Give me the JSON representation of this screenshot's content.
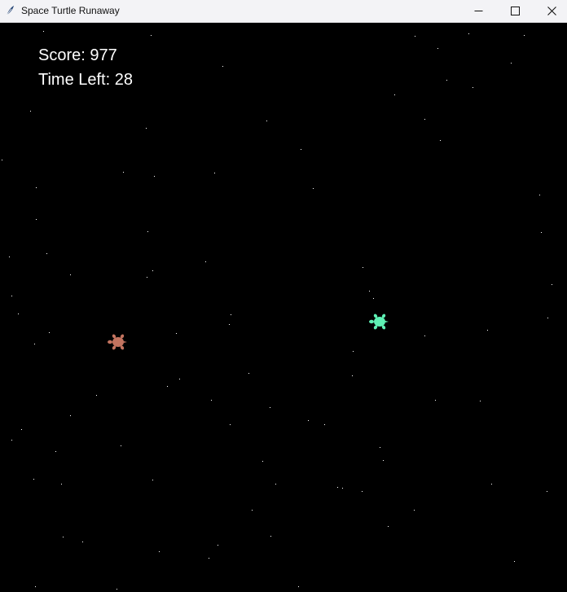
{
  "window": {
    "title": "Space Turtle Runaway",
    "app_icon": "feather-icon",
    "controls": [
      "minimize-icon",
      "maximize-icon",
      "close-icon"
    ]
  },
  "hud": {
    "score_text": "Score: 977",
    "time_text": "Time Left: 28"
  },
  "game": {
    "background_color": "#000000",
    "star_color": "#ffffff",
    "turtles": [
      {
        "role": "chaser",
        "icon": "turtle-icon",
        "color": "#c2735f"
      },
      {
        "role": "runaway",
        "icon": "turtle-icon",
        "color": "#5ef0b4"
      }
    ]
  }
}
